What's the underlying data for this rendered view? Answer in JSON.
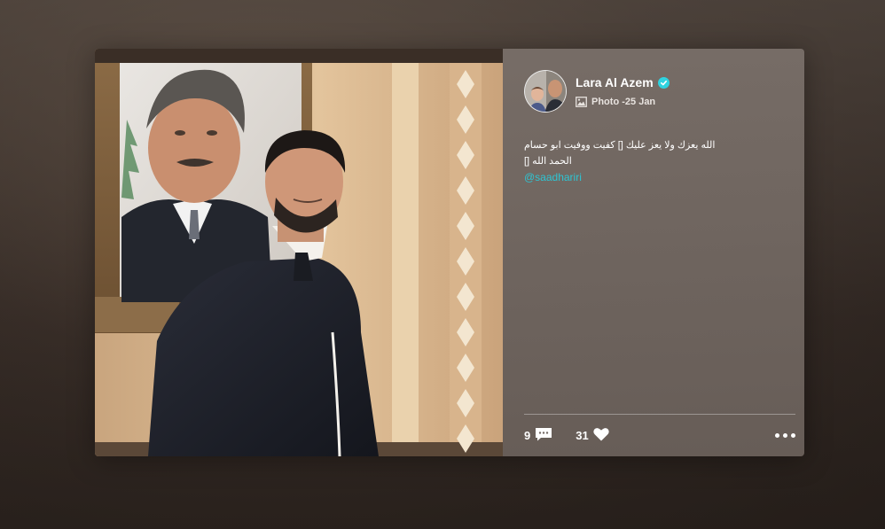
{
  "post": {
    "author_name": "Lara Al Azem",
    "verified": true,
    "post_type": "Photo",
    "separator": " -",
    "date": "25 Jan",
    "caption_line1": "الله يعزك ولا يعز عليك [] كفيت ووفيت ابو حسام",
    "caption_line2": "[] الحمد الله",
    "mention": "@saadhariri",
    "comments_count": "9",
    "likes_count": "31"
  },
  "icons": {
    "verified": "verified-check-icon",
    "photo": "photo-icon",
    "comment": "comment-icon",
    "like": "heart-icon",
    "more": "more-dots-icon"
  },
  "colors": {
    "accent": "#2ec5d3",
    "verified": "#2fd3e0",
    "panel": "#746a64"
  }
}
